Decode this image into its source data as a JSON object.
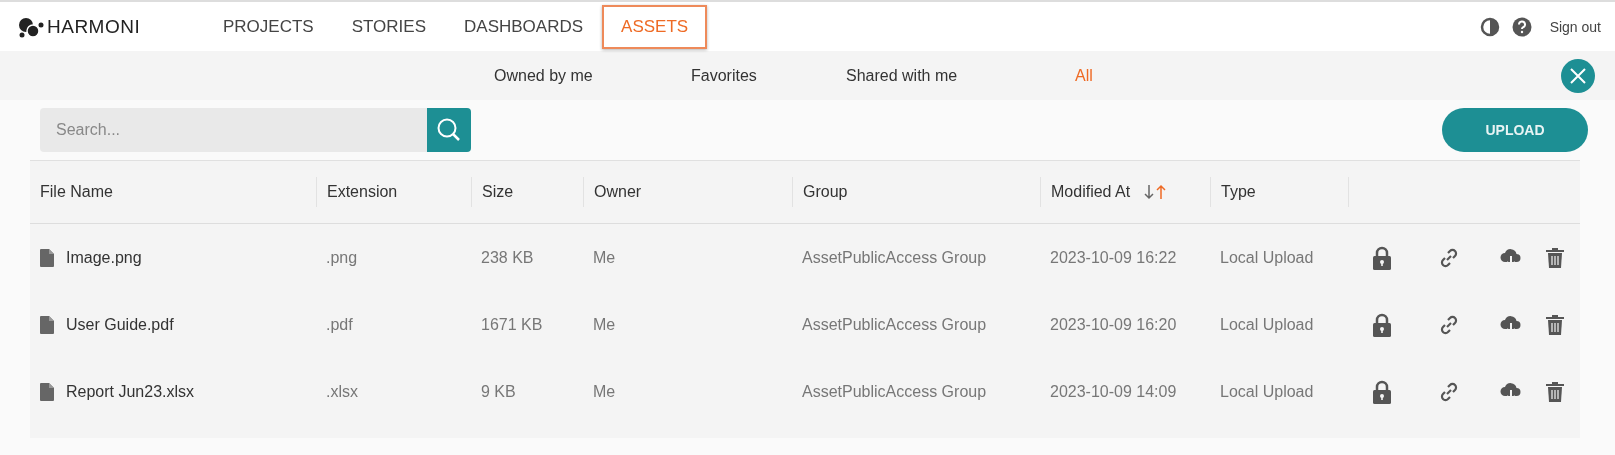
{
  "brand": {
    "name": "HARMONI"
  },
  "nav": {
    "tabs": [
      {
        "label": "PROJECTS",
        "selected": false
      },
      {
        "label": "STORIES",
        "selected": false
      },
      {
        "label": "DASHBOARDS",
        "selected": false
      },
      {
        "label": "ASSETS",
        "selected": true
      }
    ],
    "sign_out": "Sign out"
  },
  "filters": [
    {
      "label": "Owned by me",
      "selected": false
    },
    {
      "label": "Favorites",
      "selected": false
    },
    {
      "label": "Shared with me",
      "selected": false
    },
    {
      "label": "All",
      "selected": true
    }
  ],
  "search": {
    "placeholder": "Search..."
  },
  "upload_button": "UPLOAD",
  "table": {
    "columns": [
      {
        "label": "File Name"
      },
      {
        "label": "Extension"
      },
      {
        "label": "Size"
      },
      {
        "label": "Owner"
      },
      {
        "label": "Group"
      },
      {
        "label": "Modified At",
        "sorted_ascending": true
      },
      {
        "label": "Type"
      }
    ],
    "rows": [
      {
        "cells": [
          "Image.png",
          ".png",
          "238 KB",
          "Me",
          "AssetPublicAccess Group",
          "2023-10-09 16:22",
          "Local Upload"
        ]
      },
      {
        "cells": [
          "User Guide.pdf",
          ".pdf",
          "1671 KB",
          "Me",
          "AssetPublicAccess Group",
          "2023-10-09 16:20",
          "Local Upload"
        ]
      },
      {
        "cells": [
          "Report Jun23.xlsx",
          ".xlsx",
          "9 KB",
          "Me",
          "AssetPublicAccess Group",
          "2023-10-09 14:09",
          "Local Upload"
        ]
      }
    ]
  }
}
